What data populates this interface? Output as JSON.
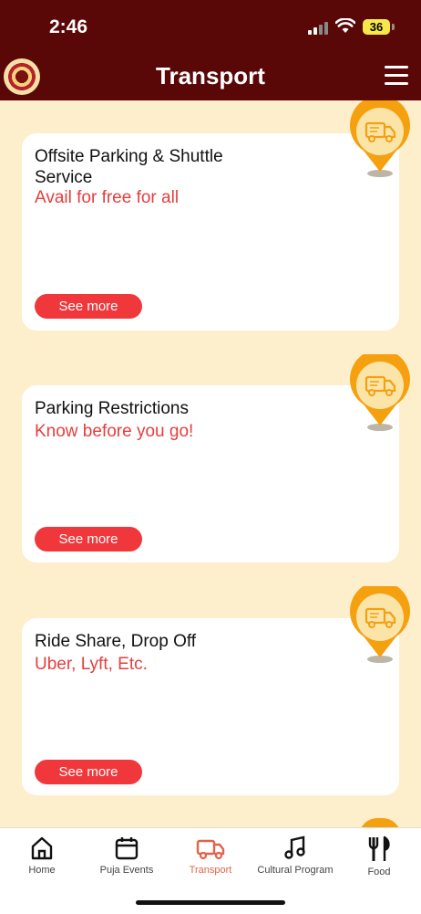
{
  "status": {
    "time": "2:46",
    "battery": "36"
  },
  "header": {
    "title": "Transport"
  },
  "cards": [
    {
      "title": "Offsite Parking & Shuttle Service",
      "subtitle": "Avail for free for all",
      "button": "See more"
    },
    {
      "title": "Parking Restrictions",
      "subtitle": "Know before you go!",
      "button": "See more"
    },
    {
      "title": "Ride Share, Drop Off",
      "subtitle": "Uber, Lyft, Etc.",
      "button": "See more"
    }
  ],
  "tabs": [
    {
      "label": "Home",
      "icon": "home-icon"
    },
    {
      "label": "Puja Events",
      "icon": "calendar-icon"
    },
    {
      "label": "Transport",
      "icon": "truck-icon",
      "active": true
    },
    {
      "label": "Cultural Program",
      "icon": "music-note-icon"
    },
    {
      "label": "Food",
      "icon": "fork-knife-icon"
    }
  ],
  "colors": {
    "header": "#5a0707",
    "background": "#fdefcc",
    "accent": "#f0383c",
    "pin": "#f5a00f"
  }
}
